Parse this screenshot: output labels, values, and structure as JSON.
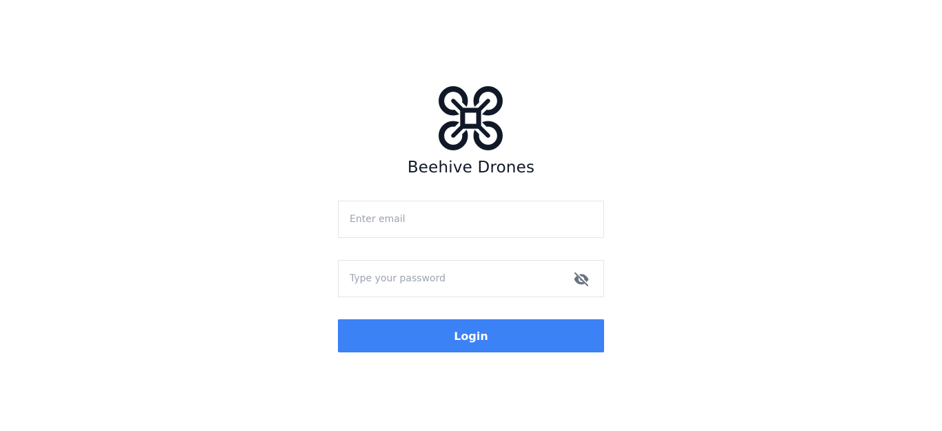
{
  "brand": {
    "name": "Beehive Drones",
    "logo_icon": "drone-icon",
    "logo_color": "#111827"
  },
  "form": {
    "email": {
      "value": "",
      "placeholder": "Enter email"
    },
    "password": {
      "value": "",
      "placeholder": "Type your password",
      "toggle_icon": "eye-off-icon"
    },
    "login_label": "Login",
    "accent_color": "#3b82f6"
  }
}
